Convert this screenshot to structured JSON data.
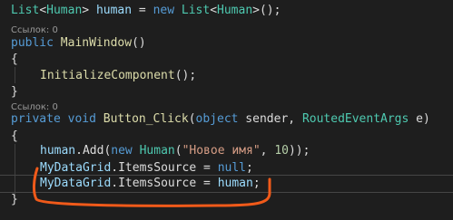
{
  "code": {
    "line1": {
      "t1": "List",
      "t2": "<",
      "t3": "Human",
      "t4": "> ",
      "t5": "human",
      "t6": " = ",
      "t7": "new",
      "t8": " ",
      "t9": "List",
      "t10": "<",
      "t11": "Human",
      "t12": ">();"
    },
    "lens1": "Ссылок: 0",
    "line2": {
      "kw": "public",
      "sp": " ",
      "name": "MainWindow",
      "rest": "()"
    },
    "line3": "{",
    "line4": {
      "name": "InitializeComponent",
      "rest": "();"
    },
    "line5": "}",
    "lens2": "Ссылок: 0",
    "line6": {
      "kw1": "private",
      "kw2": "void",
      "name": "Button_Click",
      "p1": "(",
      "kw3": "object",
      "p2": " sender, ",
      "type": "RoutedEventArgs",
      "p3": " e)"
    },
    "line7": "{",
    "line8": {
      "obj": "human",
      "m": ".Add(",
      "kw": "new",
      "sp": " ",
      "type": "Human",
      "p1": "(",
      "str": "\"Новое имя\"",
      "p2": ", ",
      "num": "10",
      "p3": "));"
    },
    "line9": {
      "obj": "MyDataGrid",
      "p1": ".",
      "prop": "ItemsSource",
      "p2": " = ",
      "kw": "null",
      "p3": ";"
    },
    "line10": {
      "obj": "MyDataGrid",
      "p1": ".",
      "prop": "ItemsSource",
      "p2": " = ",
      "val": "human",
      "p3": ";"
    },
    "line11": "}"
  },
  "colors": {
    "annotation": "#f05a1a",
    "background": "#1e1e1e"
  }
}
